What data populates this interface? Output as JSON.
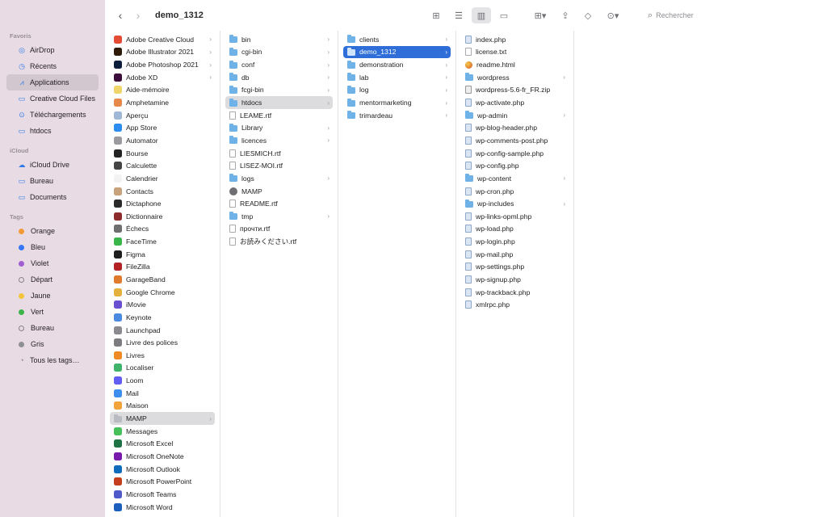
{
  "window": {
    "title": "demo_1312"
  },
  "toolbar": {
    "search_placeholder": "Rechercher"
  },
  "sidebar": {
    "favorites_label": "Favoris",
    "favorites": [
      {
        "label": "AirDrop",
        "icon": "airdrop-icon",
        "glyph": "◎"
      },
      {
        "label": "Récents",
        "icon": "clock-icon",
        "glyph": "◷"
      },
      {
        "label": "Applications",
        "icon": "applications-icon",
        "glyph": "⩘",
        "selected": true
      },
      {
        "label": "Creative Cloud Files",
        "icon": "document-icon",
        "glyph": "▭"
      },
      {
        "label": "Téléchargements",
        "icon": "download-icon",
        "glyph": "⊙"
      },
      {
        "label": "htdocs",
        "icon": "folder-icon",
        "glyph": "▭"
      }
    ],
    "icloud_label": "iCloud",
    "icloud": [
      {
        "label": "iCloud Drive",
        "icon": "cloud-icon",
        "glyph": "☁"
      },
      {
        "label": "Bureau",
        "icon": "desktop-icon",
        "glyph": "▭"
      },
      {
        "label": "Documents",
        "icon": "documents-icon",
        "glyph": "▭"
      }
    ],
    "tags_label": "Tags",
    "tags": [
      {
        "label": "Orange",
        "color": "#f29a38"
      },
      {
        "label": "Bleu",
        "color": "#3478f6"
      },
      {
        "label": "Violet",
        "color": "#a05fd1"
      },
      {
        "label": "Départ",
        "color": ""
      },
      {
        "label": "Jaune",
        "color": "#f2c33b"
      },
      {
        "label": "Vert",
        "color": "#3cb44b"
      },
      {
        "label": "Bureau",
        "color": ""
      },
      {
        "label": "Gris",
        "color": "#8e8e93"
      },
      {
        "label": "Tous les tags…",
        "color": "all"
      }
    ]
  },
  "columns": [
    {
      "name": "applications",
      "width": 143,
      "items": [
        {
          "label": "Adobe Creative Cloud",
          "type": "app",
          "color": "#e34c33",
          "folder": true
        },
        {
          "label": "Adobe Illustrator 2021",
          "type": "app",
          "color": "#2e1a05",
          "folder": true
        },
        {
          "label": "Adobe Photoshop 2021",
          "type": "app",
          "color": "#0c1d3c",
          "folder": true
        },
        {
          "label": "Adobe XD",
          "type": "app",
          "color": "#3b0b3a",
          "folder": true
        },
        {
          "label": "Aide-mémoire",
          "type": "app",
          "color": "#f0d66a"
        },
        {
          "label": "Amphetamine",
          "type": "app",
          "color": "#e5884a"
        },
        {
          "label": "Aperçu",
          "type": "app",
          "color": "#9fb8d6"
        },
        {
          "label": "App Store",
          "type": "app",
          "color": "#2c8cf2"
        },
        {
          "label": "Automator",
          "type": "app",
          "color": "#9a9a9f"
        },
        {
          "label": "Bourse",
          "type": "app",
          "color": "#222222"
        },
        {
          "label": "Calculette",
          "type": "app",
          "color": "#444444"
        },
        {
          "label": "Calendrier",
          "type": "app",
          "color": "#f3f3f3"
        },
        {
          "label": "Contacts",
          "type": "app",
          "color": "#c7a27a"
        },
        {
          "label": "Dictaphone",
          "type": "app",
          "color": "#2a2a2a"
        },
        {
          "label": "Dictionnaire",
          "type": "app",
          "color": "#8c2b2b"
        },
        {
          "label": "Échecs",
          "type": "app",
          "color": "#6e6e6e"
        },
        {
          "label": "FaceTime",
          "type": "app",
          "color": "#39b54a"
        },
        {
          "label": "Figma",
          "type": "app",
          "color": "#1e1e1e"
        },
        {
          "label": "FileZilla",
          "type": "app",
          "color": "#b22222"
        },
        {
          "label": "GarageBand",
          "type": "app",
          "color": "#e07a2c"
        },
        {
          "label": "Google Chrome",
          "type": "app",
          "color": "#e2b23c"
        },
        {
          "label": "iMovie",
          "type": "app",
          "color": "#6a4fd1"
        },
        {
          "label": "Keynote",
          "type": "app",
          "color": "#4a8ae0"
        },
        {
          "label": "Launchpad",
          "type": "app",
          "color": "#8a8a90"
        },
        {
          "label": "Livre des polices",
          "type": "app",
          "color": "#7c7c80"
        },
        {
          "label": "Livres",
          "type": "app",
          "color": "#f08a24"
        },
        {
          "label": "Localiser",
          "type": "app",
          "color": "#3fb36a"
        },
        {
          "label": "Loom",
          "type": "app",
          "color": "#625df5"
        },
        {
          "label": "Mail",
          "type": "app",
          "color": "#3e8ef0"
        },
        {
          "label": "Maison",
          "type": "app",
          "color": "#f2a33a"
        },
        {
          "label": "MAMP",
          "type": "folder-gray",
          "folder": true,
          "highlight": true
        },
        {
          "label": "Messages",
          "type": "app",
          "color": "#46c15a"
        },
        {
          "label": "Microsoft Excel",
          "type": "app",
          "color": "#1f7244"
        },
        {
          "label": "Microsoft OneNote",
          "type": "app",
          "color": "#7719aa"
        },
        {
          "label": "Microsoft Outlook",
          "type": "app",
          "color": "#0f6cbd"
        },
        {
          "label": "Microsoft PowerPoint",
          "type": "app",
          "color": "#c43e1c"
        },
        {
          "label": "Microsoft Teams",
          "type": "app",
          "color": "#5059c9"
        },
        {
          "label": "Microsoft Word",
          "type": "app",
          "color": "#1b5ebe"
        }
      ]
    },
    {
      "name": "mamp",
      "width": 146,
      "items": [
        {
          "label": "bin",
          "type": "folder",
          "folder": true
        },
        {
          "label": "cgi-bin",
          "type": "folder",
          "folder": true
        },
        {
          "label": "conf",
          "type": "folder",
          "folder": true
        },
        {
          "label": "db",
          "type": "folder",
          "folder": true
        },
        {
          "label": "fcgi-bin",
          "type": "folder",
          "folder": true
        },
        {
          "label": "htdocs",
          "type": "folder",
          "folder": true,
          "highlight": true
        },
        {
          "label": "LEAME.rtf",
          "type": "doc"
        },
        {
          "label": "Library",
          "type": "folder",
          "folder": true
        },
        {
          "label": "licences",
          "type": "folder",
          "folder": true
        },
        {
          "label": "LIESMICH.rtf",
          "type": "doc"
        },
        {
          "label": "LISEZ-MOI.rtf",
          "type": "doc"
        },
        {
          "label": "logs",
          "type": "folder",
          "folder": true
        },
        {
          "label": "MAMP",
          "type": "mamp"
        },
        {
          "label": "README.rtf",
          "type": "doc"
        },
        {
          "label": "tmp",
          "type": "folder",
          "folder": true
        },
        {
          "label": "прочти.rtf",
          "type": "doc"
        },
        {
          "label": "お読みください.rtf",
          "type": "doc"
        }
      ]
    },
    {
      "name": "htdocs",
      "width": 146,
      "items": [
        {
          "label": "clients",
          "type": "folder",
          "folder": true
        },
        {
          "label": "demo_1312",
          "type": "folder",
          "folder": true,
          "selected": true
        },
        {
          "label": "demonstration",
          "type": "folder",
          "folder": true
        },
        {
          "label": "lab",
          "type": "folder",
          "folder": true
        },
        {
          "label": "log",
          "type": "folder",
          "folder": true
        },
        {
          "label": "mentormarketing",
          "type": "folder",
          "folder": true
        },
        {
          "label": "trimardeau",
          "type": "folder",
          "folder": true
        }
      ]
    },
    {
      "name": "demo_1312",
      "width": 146,
      "items": [
        {
          "label": "index.php",
          "type": "php"
        },
        {
          "label": "license.txt",
          "type": "doc"
        },
        {
          "label": "readme.html",
          "type": "html"
        },
        {
          "label": "wordpress",
          "type": "folder",
          "folder": true
        },
        {
          "label": "wordpress-5.6-fr_FR.zip",
          "type": "zip"
        },
        {
          "label": "wp-activate.php",
          "type": "php"
        },
        {
          "label": "wp-admin",
          "type": "folder",
          "folder": true
        },
        {
          "label": "wp-blog-header.php",
          "type": "php"
        },
        {
          "label": "wp-comments-post.php",
          "type": "php"
        },
        {
          "label": "wp-config-sample.php",
          "type": "php"
        },
        {
          "label": "wp-config.php",
          "type": "php"
        },
        {
          "label": "wp-content",
          "type": "folder",
          "folder": true
        },
        {
          "label": "wp-cron.php",
          "type": "php"
        },
        {
          "label": "wp-includes",
          "type": "folder",
          "folder": true
        },
        {
          "label": "wp-links-opml.php",
          "type": "php"
        },
        {
          "label": "wp-load.php",
          "type": "php"
        },
        {
          "label": "wp-login.php",
          "type": "php"
        },
        {
          "label": "wp-mail.php",
          "type": "php"
        },
        {
          "label": "wp-settings.php",
          "type": "php"
        },
        {
          "label": "wp-signup.php",
          "type": "php"
        },
        {
          "label": "wp-trackback.php",
          "type": "php"
        },
        {
          "label": "xmlrpc.php",
          "type": "php"
        }
      ]
    }
  ]
}
